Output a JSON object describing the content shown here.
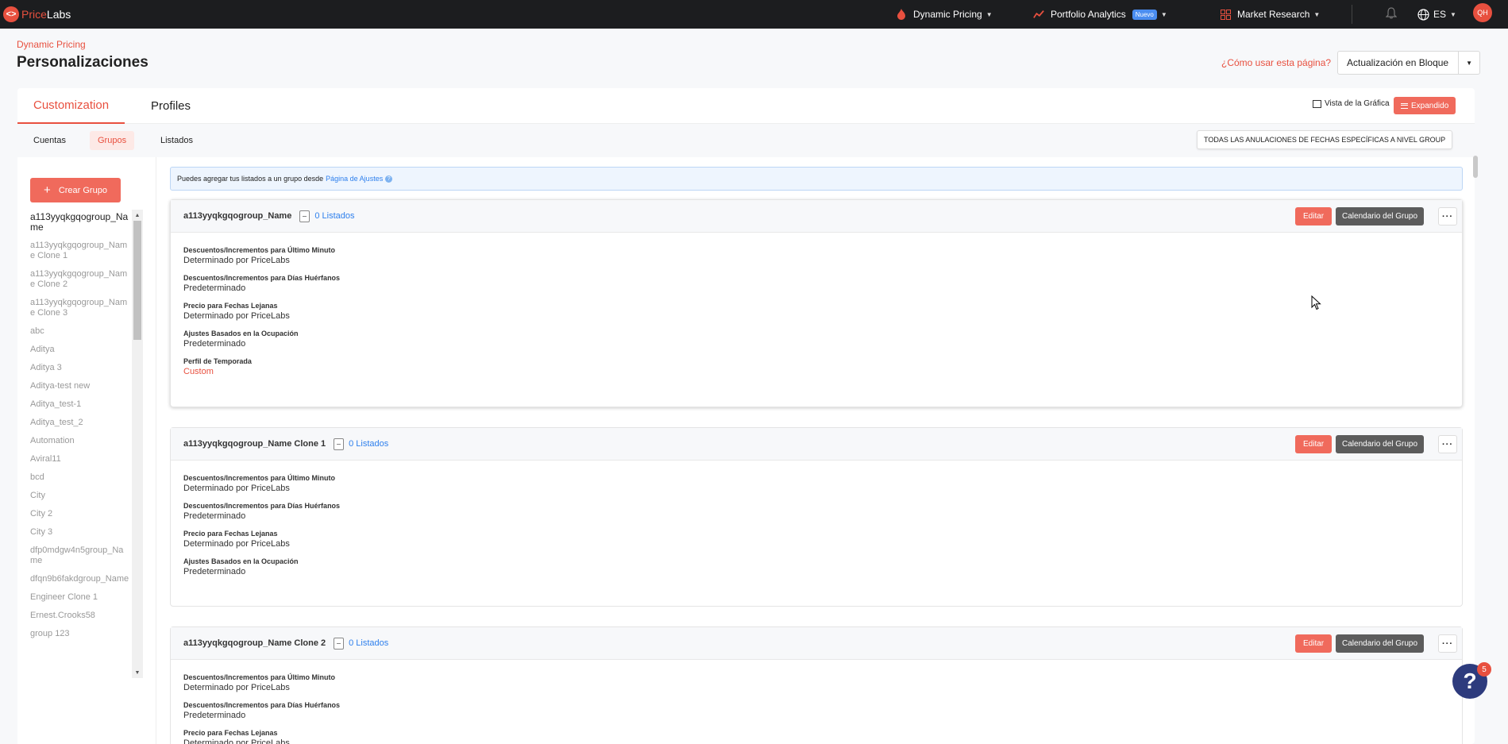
{
  "app": {
    "logo_a": "Price",
    "logo_b": "Labs"
  },
  "nav": {
    "dynamic_pricing": "Dynamic Pricing",
    "portfolio_analytics": "Portfolio Analytics",
    "new_badge": "Nuevo",
    "market_research": "Market Research",
    "language": "ES",
    "avatar_initials": "QH"
  },
  "header": {
    "breadcrumb": "Dynamic Pricing",
    "title": "Personalizaciones",
    "how_to": "¿Cómo usar esta página?",
    "bulk_update": "Actualización en Bloque"
  },
  "tabs": {
    "customization": "Customization",
    "profiles": "Profiles"
  },
  "view": {
    "graph_view": "Vista de la Gráfica",
    "expanded": "Expandido"
  },
  "subtabs": {
    "accounts": "Cuentas",
    "groups": "Grupos",
    "listings": "Listados"
  },
  "all_overrides": "TODAS LAS ANULACIONES DE FECHAS ESPECÍFICAS A NIVEL GROUP",
  "sidebar": {
    "create_group": "Crear Grupo",
    "groups": [
      "a113yyqkgqogroup_Name",
      "a113yyqkgqogroup_Name Clone 1",
      "a113yyqkgqogroup_Name Clone 2",
      "a113yyqkgqogroup_Name Clone 3",
      "abc",
      "Aditya",
      "Aditya 3",
      "Aditya-test new",
      "Aditya_test-1",
      "Aditya_test_2",
      "Automation",
      "Aviral11",
      "bcd",
      "City",
      "City 2",
      "City 3",
      "dfp0mdgw4n5group_Name",
      "dfqn9b6fakdgroup_Name",
      "Engineer Clone 1",
      "Ernest.Crooks58",
      "group 123"
    ]
  },
  "info": {
    "text": "Puedes agregar tus listados a un grupo desde",
    "link": "Página de Ajustes"
  },
  "card_buttons": {
    "edit": "Editar",
    "calendar": "Calendario del Grupo"
  },
  "cards": [
    {
      "name": "a113yyqkgqogroup_Name",
      "listings": "0 Listados",
      "rows": [
        {
          "k": "Descuentos/Incrementos para Último Minuto",
          "v": "Determinado por PriceLabs"
        },
        {
          "k": "Descuentos/Incrementos para Días Huérfanos",
          "v": "Predeterminado"
        },
        {
          "k": "Precio para Fechas Lejanas",
          "v": "Determinado por PriceLabs"
        },
        {
          "k": "Ajustes Basados en la Ocupación",
          "v": "Predeterminado"
        },
        {
          "k": "Perfil de Temporada",
          "v": "Custom"
        }
      ]
    },
    {
      "name": "a113yyqkgqogroup_Name Clone 1",
      "listings": "0 Listados",
      "rows": [
        {
          "k": "Descuentos/Incrementos para Último Minuto",
          "v": "Determinado por PriceLabs"
        },
        {
          "k": "Descuentos/Incrementos para Días Huérfanos",
          "v": "Predeterminado"
        },
        {
          "k": "Precio para Fechas Lejanas",
          "v": "Determinado por PriceLabs"
        },
        {
          "k": "Ajustes Basados en la Ocupación",
          "v": "Predeterminado"
        }
      ]
    },
    {
      "name": "a113yyqkgqogroup_Name Clone 2",
      "listings": "0 Listados",
      "rows": [
        {
          "k": "Descuentos/Incrementos para Último Minuto",
          "v": "Determinado por PriceLabs"
        },
        {
          "k": "Descuentos/Incrementos para Días Huérfanos",
          "v": "Predeterminado"
        },
        {
          "k": "Precio para Fechas Lejanas",
          "v": "Determinado por PriceLabs"
        }
      ]
    }
  ],
  "help_badge": "5",
  "colors": {
    "accent": "#e8503f",
    "button": "#f06a5c",
    "link": "#2f80ed",
    "nav_bg": "#1c1d1f"
  }
}
